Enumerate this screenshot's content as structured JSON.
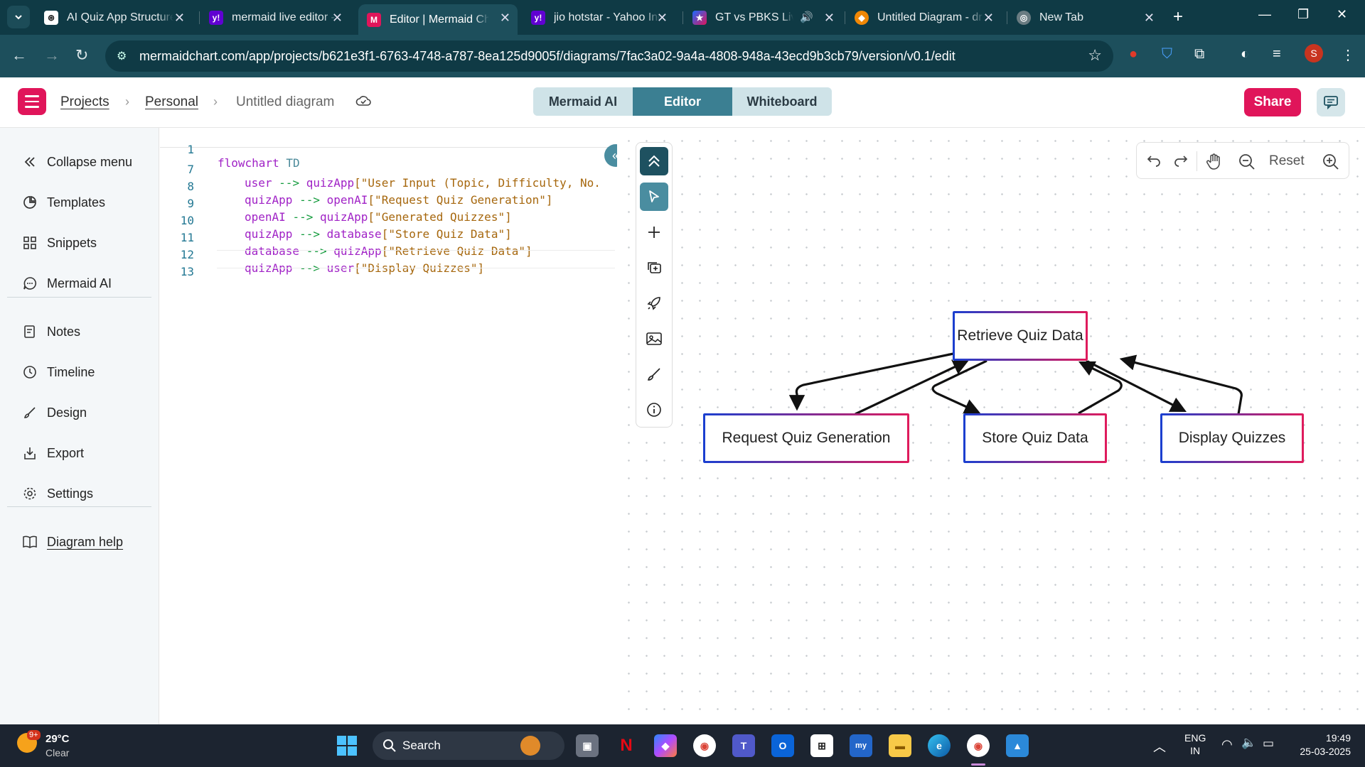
{
  "browser": {
    "tabs": [
      {
        "title": "AI Quiz App Structure",
        "icon": "chatgpt-icon"
      },
      {
        "title": "mermaid live editor - Y",
        "icon": "yahoo-icon"
      },
      {
        "title": "Editor | Mermaid Chart",
        "icon": "mermaid-chart-icon",
        "active": true
      },
      {
        "title": "jio hotstar - Yahoo Ind",
        "icon": "yahoo-icon"
      },
      {
        "title": "GT vs PBKS Live w",
        "icon": "hotstar-icon"
      },
      {
        "title": "Untitled Diagram - dr",
        "icon": "drawio-icon"
      },
      {
        "title": "New Tab",
        "icon": "chrome-icon"
      }
    ],
    "url": "mermaidchart.com/app/projects/b621e3f1-6763-4748-a787-8ea125d9005f/diagrams/7fac3a02-9a4a-4808-948a-43ecd9b3cb79/version/v0.1/edit",
    "profile_initial": "S"
  },
  "header": {
    "breadcrumb": {
      "projects": "Projects",
      "personal": "Personal",
      "diagram": "Untitled diagram"
    },
    "modes": {
      "ai": "Mermaid AI",
      "editor": "Editor",
      "whiteboard": "Whiteboard"
    },
    "share": "Share"
  },
  "sidebar": {
    "collapse": "Collapse menu",
    "templates": "Templates",
    "snippets": "Snippets",
    "mermaid_ai": "Mermaid AI",
    "notes": "Notes",
    "timeline": "Timeline",
    "design": "Design",
    "export": "Export",
    "settings": "Settings",
    "help": "Diagram help"
  },
  "editor": {
    "lines": [
      {
        "n": "1",
        "kw": "flowchart",
        "dir": "TD"
      },
      {
        "n": "7",
        "from": "user",
        "arrow": "-->",
        "to": "quizApp",
        "label": "[\"User Input (Topic, Difficulty, No."
      },
      {
        "n": "8",
        "from": "quizApp",
        "arrow": "-->",
        "to": "openAI",
        "label": "[\"Request Quiz Generation\"]"
      },
      {
        "n": "9",
        "from": "openAI",
        "arrow": "-->",
        "to": "quizApp",
        "label": "[\"Generated Quizzes\"]"
      },
      {
        "n": "10",
        "from": "quizApp",
        "arrow": "-->",
        "to": "database",
        "label": "[\"Store Quiz Data\"]"
      },
      {
        "n": "11",
        "from": "database",
        "arrow": "-->",
        "to": "quizApp",
        "label": "[\"Retrieve Quiz Data\"]"
      },
      {
        "n": "12",
        "from": "quizApp",
        "arrow": "-->",
        "to": "user",
        "label": "[\"Display Quizzes\"]"
      },
      {
        "n": "13"
      }
    ]
  },
  "canvas": {
    "zoom_reset": "Reset",
    "nodes": {
      "retrieve": "Retrieve Quiz Data",
      "request": "Request Quiz Generation",
      "store": "Store Quiz Data",
      "display": "Display Quizzes"
    }
  },
  "taskbar": {
    "weather_temp": "29°C",
    "weather_desc": "Clear",
    "weather_badge": "9+",
    "search": "Search",
    "lang1": "ENG",
    "lang2": "IN",
    "time": "19:49",
    "date": "25-03-2025"
  },
  "colors": {
    "brand": "#e0155a",
    "accent": "#3b7f92",
    "node_start": "#1a3fd0",
    "node_end": "#e01b5c"
  }
}
